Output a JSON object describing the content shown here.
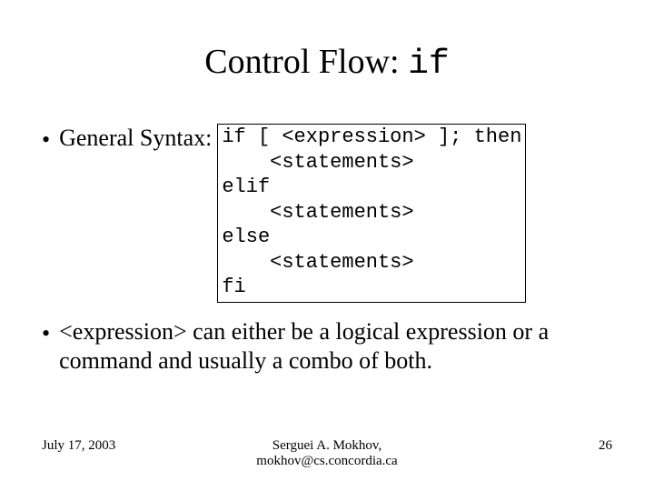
{
  "title": {
    "text": "Control Flow: ",
    "code": "if"
  },
  "bullets": {
    "syntax_label": "General Syntax:",
    "body": "<expression> can either be a logical expression or a command and usually a combo of both."
  },
  "code": {
    "l1": "if [ <expression> ]; then",
    "l2": "    <statements>",
    "l3": "elif",
    "l4": "    <statements>",
    "l5": "else",
    "l6": "    <statements>",
    "l7": "fi"
  },
  "footer": {
    "date": "July 17, 2003",
    "author": "Serguei A. Mokhov,",
    "email": "mokhov@cs.concordia.ca",
    "page": "26"
  }
}
